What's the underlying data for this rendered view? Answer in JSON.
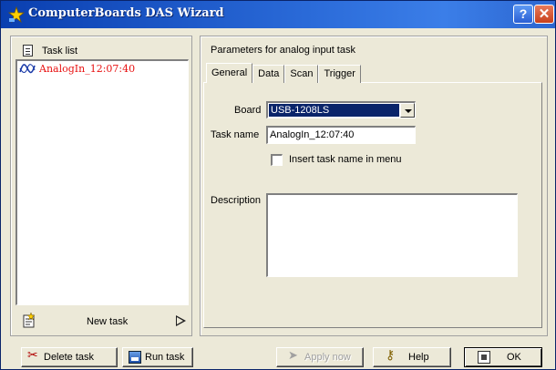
{
  "window": {
    "title": "ComputerBoards DAS Wizard",
    "help_glyph": "?",
    "close_glyph": "✕"
  },
  "task_list": {
    "header": "Task list",
    "items": [
      {
        "label": "AnalogIn_12:07:40",
        "color": "#e81010"
      }
    ],
    "new_task_label": "New task"
  },
  "parameters": {
    "heading": "Parameters for analog input task",
    "tabs": [
      {
        "label": "General",
        "active": true
      },
      {
        "label": "Data",
        "active": false
      },
      {
        "label": "Scan",
        "active": false
      },
      {
        "label": "Trigger",
        "active": false
      }
    ],
    "board_label": "Board",
    "board_value": "USB-1208LS",
    "task_name_label": "Task name",
    "task_name_value": "AnalogIn_12:07:40",
    "insert_checkbox_label": "Insert task name in menu",
    "insert_checked": false,
    "description_label": "Description",
    "description_value": ""
  },
  "buttons": {
    "delete": "Delete task",
    "run": "Run task",
    "apply": "Apply now",
    "help": "Help",
    "ok": "OK"
  },
  "colors": {
    "titlebar": "#2a6ad8",
    "selection": "#0a246a",
    "task_text": "#e81010",
    "window_bg": "#ece9d8"
  }
}
